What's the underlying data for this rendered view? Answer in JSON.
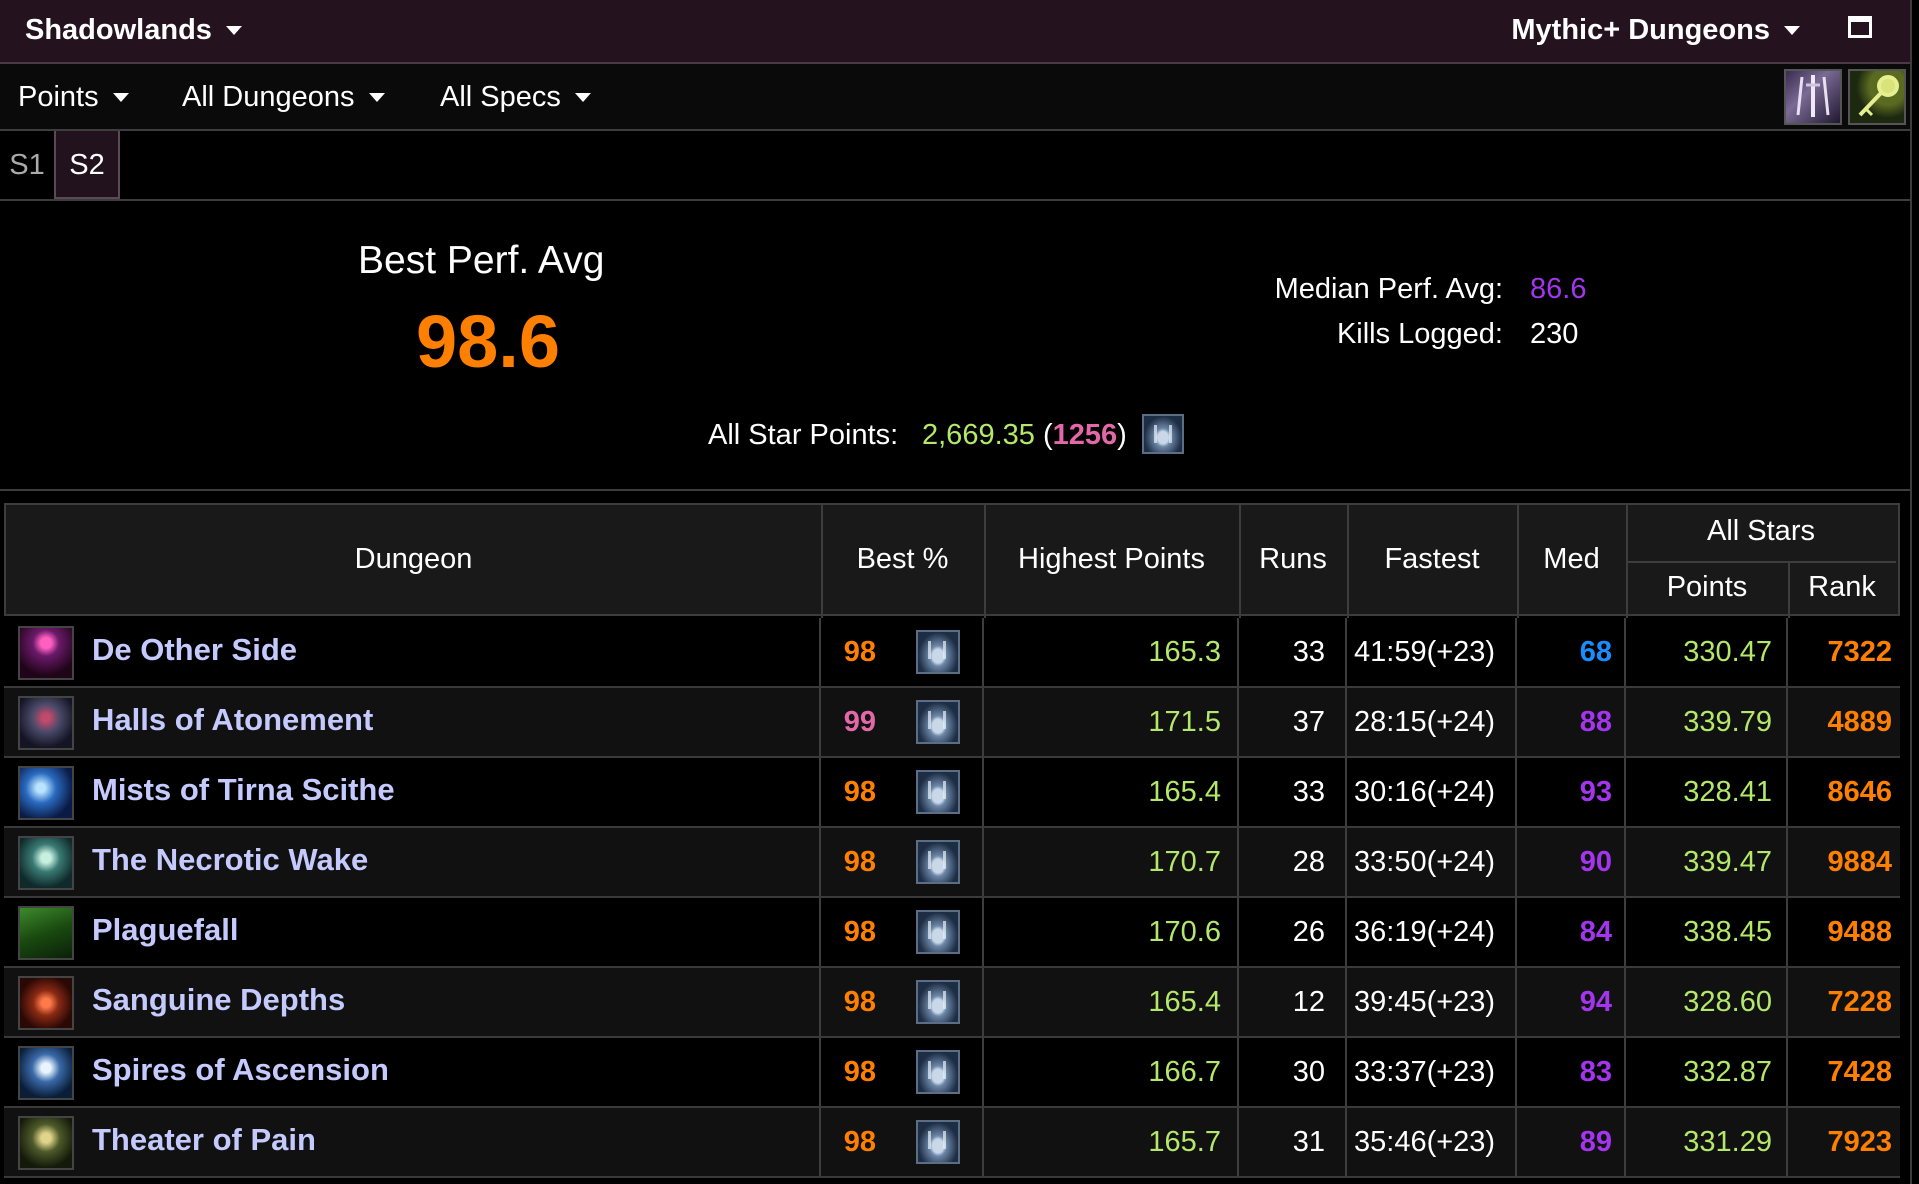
{
  "topbar": {
    "expansion": "Shadowlands",
    "zone": "Mythic+ Dungeons"
  },
  "filters": {
    "metric": "Points",
    "dungeons": "All Dungeons",
    "specs": "All Specs"
  },
  "seasons": [
    "S1",
    "S2"
  ],
  "summary": {
    "best_perf_label": "Best Perf. Avg",
    "best_perf_value": "98.6",
    "median_label": "Median Perf. Avg:",
    "median_value": "86.6",
    "kills_label": "Kills Logged:",
    "kills_value": "230",
    "allstar_label": "All Star Points:",
    "allstar_points": "2,669.35",
    "allstar_open": " (",
    "allstar_rank": "1256",
    "allstar_close": ")"
  },
  "table": {
    "headers": {
      "dungeon": "Dungeon",
      "best": "Best %",
      "highest_points": "Highest Points",
      "runs": "Runs",
      "fastest": "Fastest",
      "med": "Med",
      "all_stars": "All Stars",
      "points": "Points",
      "rank": "Rank"
    },
    "rows": [
      {
        "name": "De Other Side",
        "best": "98",
        "best_color": "#ff8000",
        "highest": "165.3",
        "runs": "33",
        "fastest": "41:59(+23)",
        "med": "68",
        "med_color": "#1a8cff",
        "points": "330.47",
        "rank": "7322",
        "icon": "dos-icon"
      },
      {
        "name": "Halls of Atonement",
        "best": "99",
        "best_color": "#e268a8",
        "highest": "171.5",
        "runs": "37",
        "fastest": "28:15(+24)",
        "med": "88",
        "med_color": "#a335ee",
        "points": "339.79",
        "rank": "4889",
        "icon": "hoa-icon"
      },
      {
        "name": "Mists of Tirna Scithe",
        "best": "98",
        "best_color": "#ff8000",
        "highest": "165.4",
        "runs": "33",
        "fastest": "30:16(+24)",
        "med": "93",
        "med_color": "#a335ee",
        "points": "328.41",
        "rank": "8646",
        "icon": "mots-icon"
      },
      {
        "name": "The Necrotic Wake",
        "best": "98",
        "best_color": "#ff8000",
        "highest": "170.7",
        "runs": "28",
        "fastest": "33:50(+24)",
        "med": "90",
        "med_color": "#a335ee",
        "points": "339.47",
        "rank": "9884",
        "icon": "nw-icon"
      },
      {
        "name": "Plaguefall",
        "best": "98",
        "best_color": "#ff8000",
        "highest": "170.6",
        "runs": "26",
        "fastest": "36:19(+24)",
        "med": "84",
        "med_color": "#a335ee",
        "points": "338.45",
        "rank": "9488",
        "icon": "pf-icon"
      },
      {
        "name": "Sanguine Depths",
        "best": "98",
        "best_color": "#ff8000",
        "highest": "165.4",
        "runs": "12",
        "fastest": "39:45(+23)",
        "med": "94",
        "med_color": "#a335ee",
        "points": "328.60",
        "rank": "7228",
        "icon": "sd-icon"
      },
      {
        "name": "Spires of Ascension",
        "best": "98",
        "best_color": "#ff8000",
        "highest": "166.7",
        "runs": "30",
        "fastest": "33:37(+23)",
        "med": "83",
        "med_color": "#a335ee",
        "points": "332.87",
        "rank": "7428",
        "icon": "soa-icon"
      },
      {
        "name": "Theater of Pain",
        "best": "98",
        "best_color": "#ff8000",
        "highest": "165.7",
        "runs": "31",
        "fastest": "35:46(+23)",
        "med": "89",
        "med_color": "#a335ee",
        "points": "331.29",
        "rank": "7923",
        "icon": "top-icon"
      }
    ]
  },
  "colors": {
    "legendary": "#ff8000",
    "artifact": "#e268a8",
    "epic": "#a335ee",
    "rare": "#1a8cff",
    "points_green": "#b4e86a",
    "dungeon_link": "#c5cafe"
  }
}
